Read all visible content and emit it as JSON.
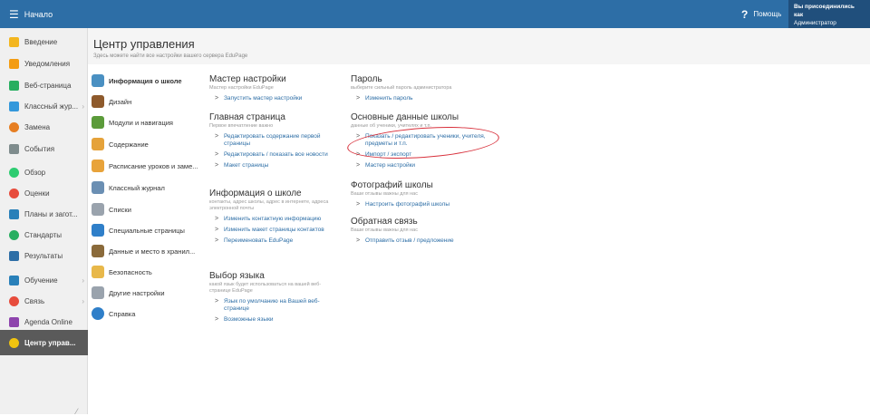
{
  "topbar": {
    "home_label": "Начало",
    "help_label": "Помощь",
    "login_line1": "Вы присоединились как",
    "login_line2": "Администратор",
    "bg_color": "#2d6ea6"
  },
  "sidebar": {
    "items": [
      {
        "label": "Введение",
        "icon": "star-icon",
        "color": "#f3b61f"
      },
      {
        "label": "Уведомления",
        "icon": "notifications-icon",
        "color": "#f39c12"
      },
      {
        "label": "Веб-страница",
        "icon": "website-icon",
        "color": "#27ae60"
      },
      {
        "label": "Классный жур...",
        "icon": "class-journal-icon",
        "color": "#3498db"
      },
      {
        "label": "Замена",
        "icon": "substitution-icon",
        "color": "#e67e22"
      },
      {
        "label": "События",
        "icon": "events-icon",
        "color": "#7f8c8d"
      },
      {
        "label": "Обзор",
        "icon": "overview-icon",
        "color": "#2ecc71"
      },
      {
        "label": "Оценки",
        "icon": "grades-icon",
        "color": "#e74c3c"
      },
      {
        "label": "Планы и загот...",
        "icon": "plans-icon",
        "color": "#2980b9"
      },
      {
        "label": "Стандарты",
        "icon": "standards-icon",
        "color": "#27ae60"
      },
      {
        "label": "Результаты",
        "icon": "results-icon",
        "color": "#2d6ea6"
      },
      {
        "label": "Обучение",
        "icon": "learning-icon",
        "color": "#2980b9"
      },
      {
        "label": "Связь",
        "icon": "communication-icon",
        "color": "#e74c3c"
      },
      {
        "label": "Agenda Online",
        "icon": "agenda-icon",
        "color": "#8e44ad"
      },
      {
        "label": "Центр управ...",
        "icon": "control-center-icon",
        "color": "#f1c40f"
      }
    ]
  },
  "header": {
    "title": "Центр управления",
    "subtitle": "Здесь можете найти все настройки вашего сервера EduPage"
  },
  "categories": [
    {
      "label": "Информация о школе",
      "icon": "school-info-icon",
      "color": "#4a90c2",
      "active": true
    },
    {
      "label": "Дизайн",
      "icon": "design-icon",
      "color": "#8e5a2c"
    },
    {
      "label": "Модули и навигация",
      "icon": "modules-icon",
      "color": "#5b9b3a"
    },
    {
      "label": "Содержание",
      "icon": "content-icon",
      "color": "#e5a23a"
    },
    {
      "label": "Расписание уроков и заме...",
      "icon": "timetable-icon",
      "color": "#e8a33a"
    },
    {
      "label": "Классный журнал",
      "icon": "journal-icon",
      "color": "#6b8fb3"
    },
    {
      "label": "Списки",
      "icon": "lists-icon",
      "color": "#9aa3ad"
    },
    {
      "label": "Специальные страницы",
      "icon": "special-pages-icon",
      "color": "#2f7fc9"
    },
    {
      "label": "Данные и место в хранил...",
      "icon": "data-storage-icon",
      "color": "#8a6a3a"
    },
    {
      "label": "Безопасность",
      "icon": "security-icon",
      "color": "#e8b84a"
    },
    {
      "label": "Другие настройки",
      "icon": "other-settings-icon",
      "color": "#9aa3ad"
    },
    {
      "label": "Справка",
      "icon": "help-book-icon",
      "color": "#2f7fc9"
    }
  ],
  "sections": {
    "wizard": {
      "title": "Мастер настройки",
      "desc": "Мастер настройки EduPage",
      "links": [
        "Запустить мастер настройки"
      ]
    },
    "homepage": {
      "title": "Главная страница",
      "desc": "Первое впечатление важно",
      "links": [
        "Редактировать содержание первой страницы",
        "Редактировать / показать все новости",
        "Макет страницы"
      ]
    },
    "school_info": {
      "title": "Информация о школе",
      "desc": "контакты, адрес школы, адрес в интернете, адреса электронной почты",
      "links": [
        "Изменить контактную информацию",
        "Изменить макет страницы контактов",
        "Переименовать EduPage"
      ]
    },
    "language": {
      "title": "Выбор языка",
      "desc": "какой язык будет использоваться на вашей веб-странице EduPage",
      "links": [
        "Язык по умолчанию на Вашей веб-странице",
        "Возможные языки"
      ]
    },
    "password": {
      "title": "Пароль",
      "desc": "выберите сильный пароль администратора",
      "links": [
        "Изменить пароль"
      ]
    },
    "school_data": {
      "title": "Основные данные школы",
      "desc": "данные об ученики, учителях и т.п.",
      "links": [
        "Показать / редактировать ученики, учителя, предметы и т.п.",
        "Импорт / экспорт",
        "Мастер настройки"
      ]
    },
    "photos": {
      "title": "Фотографий школы",
      "desc": "Ваши отзывы важны для нас",
      "links": [
        "Настроить фотографий школы"
      ]
    },
    "feedback": {
      "title": "Обратная связь",
      "desc": "Ваши отзывы важны для нас",
      "links": [
        "Отправить отзыв / предложение"
      ]
    }
  }
}
